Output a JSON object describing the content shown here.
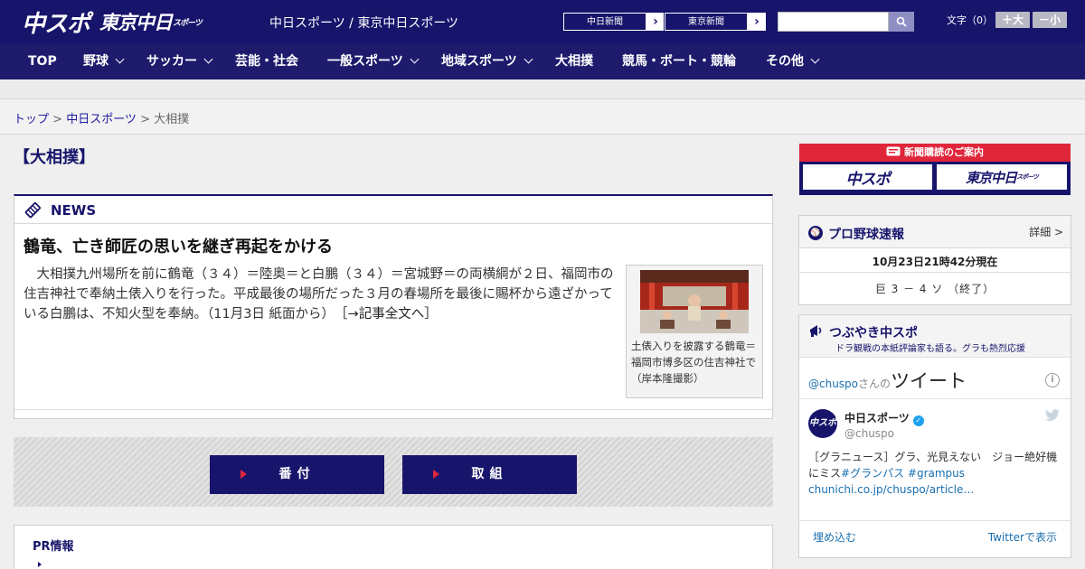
{
  "header": {
    "logo_chuspo": "中スポ",
    "logo_tokyo": "東京中日",
    "logo_tokyo_small": "スポーツ",
    "site_title": "中日スポーツ / 東京中日スポーツ",
    "ext_links": [
      {
        "label": "中日新聞",
        "arrow": "›"
      },
      {
        "label": "東京新聞",
        "arrow": "›"
      }
    ],
    "search": {
      "value": "",
      "placeholder": ""
    },
    "font_size_label": "文字（0）",
    "font_bigger": "＋大",
    "font_smaller": "－小"
  },
  "nav": [
    {
      "label": "TOP",
      "dropdown": false
    },
    {
      "label": "野球",
      "dropdown": true
    },
    {
      "label": "サッカー",
      "dropdown": true
    },
    {
      "label": "芸能・社会",
      "dropdown": false
    },
    {
      "label": "一般スポーツ",
      "dropdown": true
    },
    {
      "label": "地域スポーツ",
      "dropdown": true
    },
    {
      "label": "大相撲",
      "dropdown": false
    },
    {
      "label": "競馬・ボート・競輪",
      "dropdown": false
    },
    {
      "label": "その他",
      "dropdown": true
    }
  ],
  "breadcrumb": {
    "top": "トップ",
    "sep": " > ",
    "chunichi": "中日スポーツ",
    "current": "大相撲"
  },
  "main": {
    "section_title": "【大相撲】",
    "news_label": "NEWS",
    "headline": "鶴竜、亡き師匠の思いを継ぎ再起をかける",
    "body": "大相撲九州場所を前に鶴竜（３４）＝陸奥＝と白鵬（３４）＝宮城野＝の両横綱が２日、福岡市の住吉神社で奉納土俵入りを行った。平成最後の場所だった３月の春場所を最後に賜杯から遠ざかっている白鵬は、不知火型を奉納。（11月3日 紙面から）",
    "more_link": "［→記事全文へ］",
    "caption": "土俵入りを披露する鶴竜＝福岡市博多区の住吉神社で（岸本隆撮影）",
    "buttons": [
      "番付",
      "取組"
    ],
    "pr_title": "PR情報"
  },
  "sidebar": {
    "subscribe_title": "新聞購読のご案内",
    "subscribe_logo_1": "中スポ",
    "subscribe_logo_2": "東京中日",
    "subscribe_logo_2_small": "スポーツ",
    "baseball": {
      "title": "プロ野球速報",
      "more": "詳細 >",
      "time": "10月23日21時42分現在",
      "score": "巨 3 － 4 ソ （終了）"
    },
    "twitter": {
      "title": "つぶやき中スポ",
      "subtitle": "ドラ観戦の本紙評論家も語る。グラも熱烈応援",
      "label_handle": "@chuspo",
      "label_san": "さんの",
      "label_tweets": "ツイート",
      "info": "i",
      "avatar": "中スポ",
      "name": "中日スポーツ",
      "handle": "@chuspo",
      "text_main": "［グラニュース］グラ、光見えない　ジョー絶好機にミス",
      "text_tag1": "#グランパス",
      "text_tag2": " #grampus",
      "text_link": "chunichi.co.jp/chuspo/article…",
      "embed": "埋め込む",
      "view": "Twitterで表示"
    }
  }
}
